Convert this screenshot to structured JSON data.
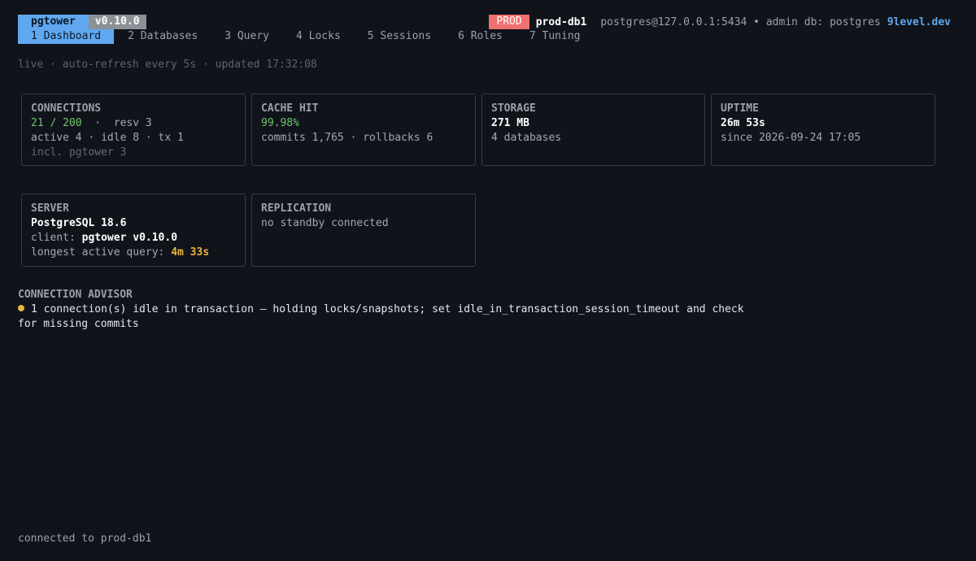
{
  "app": {
    "name": "pgtower",
    "version": "v0.10.0"
  },
  "tabs": [
    {
      "label": "1 Dashboard",
      "active": true
    },
    {
      "label": "2 Databases",
      "active": false
    },
    {
      "label": "3 Query",
      "active": false
    },
    {
      "label": "4 Locks",
      "active": false
    },
    {
      "label": "5 Sessions",
      "active": false
    },
    {
      "label": "6 Roles",
      "active": false
    },
    {
      "label": "7 Tuning",
      "active": false
    }
  ],
  "header": {
    "env_badge": "PROD",
    "server_name": "prod-db1",
    "connection_info": "postgres@127.0.0.1:5434 • admin db: postgres",
    "vendor": "9level.dev"
  },
  "status_line": "live · auto-refresh every 5s · updated 17:32:08",
  "cards": {
    "connections": {
      "title": "CONNECTIONS",
      "used": "21 / 200",
      "reserved": "  ·  resv 3",
      "breakdown": "active 4 · idle 8 · tx 1",
      "note": "incl. pgtower 3"
    },
    "cache_hit": {
      "title": "CACHE HIT",
      "ratio": "99.98%",
      "detail": "commits 1,765 · rollbacks 6"
    },
    "storage": {
      "title": "STORAGE",
      "size": "271 MB",
      "detail": "4 databases"
    },
    "uptime": {
      "title": "UPTIME",
      "value": "26m 53s",
      "since": "since 2026-09-24 17:05"
    },
    "server": {
      "title": "SERVER",
      "version": "PostgreSQL 18.6",
      "client_label": "client: ",
      "client_value": "pgtower v0.10.0",
      "longest_label": "longest active query: ",
      "longest_value": "4m 33s"
    },
    "replication": {
      "title": "REPLICATION",
      "detail": "no standby connected"
    }
  },
  "advisor": {
    "title": "CONNECTION ADVISOR",
    "items": [
      "1 connection(s) idle in transaction — holding locks/snapshots; set idle_in_transaction_session_timeout and check for missing commits"
    ]
  },
  "footer": "connected to prod-db1",
  "colors": {
    "background": "#10131a",
    "accent": "#5fa8ef",
    "prod_badge": "#f07070",
    "ok": "#6fc76f",
    "warning": "#e8b53e"
  }
}
